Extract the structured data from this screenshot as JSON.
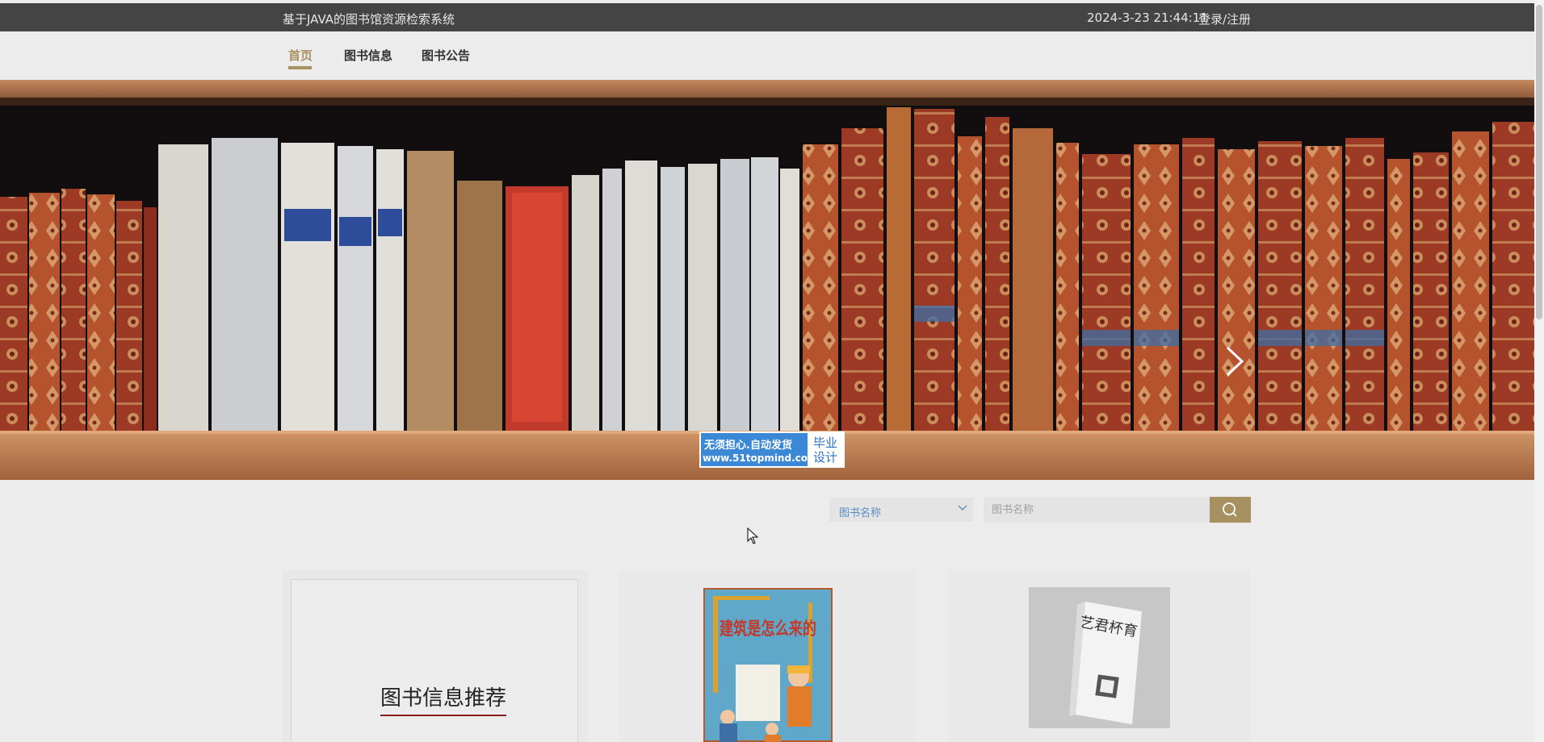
{
  "header": {
    "site_title": "基于JAVA的图书馆资源检索系统",
    "datetime": "2024-3-23 21:44:11",
    "login_label": "登录/注册"
  },
  "nav": {
    "items": [
      {
        "label": "首页",
        "active": true
      },
      {
        "label": "图书信息",
        "active": false
      },
      {
        "label": "图书公告",
        "active": false
      }
    ],
    "accent_color": "#a79160"
  },
  "banner": {
    "slide_count": 3,
    "watermark": {
      "line1": "无须担心.自动发货",
      "line2": "www.51topmind.com",
      "box_line1": "毕业",
      "box_line2": "设计"
    }
  },
  "search": {
    "select_value": "图书名称",
    "input_placeholder": "图书名称",
    "button_icon": "search-icon"
  },
  "recommend": {
    "title": "图书信息推荐",
    "book1_cover_title": "建筑是怎么来的",
    "book2_cover_title": "艺君杯育"
  }
}
